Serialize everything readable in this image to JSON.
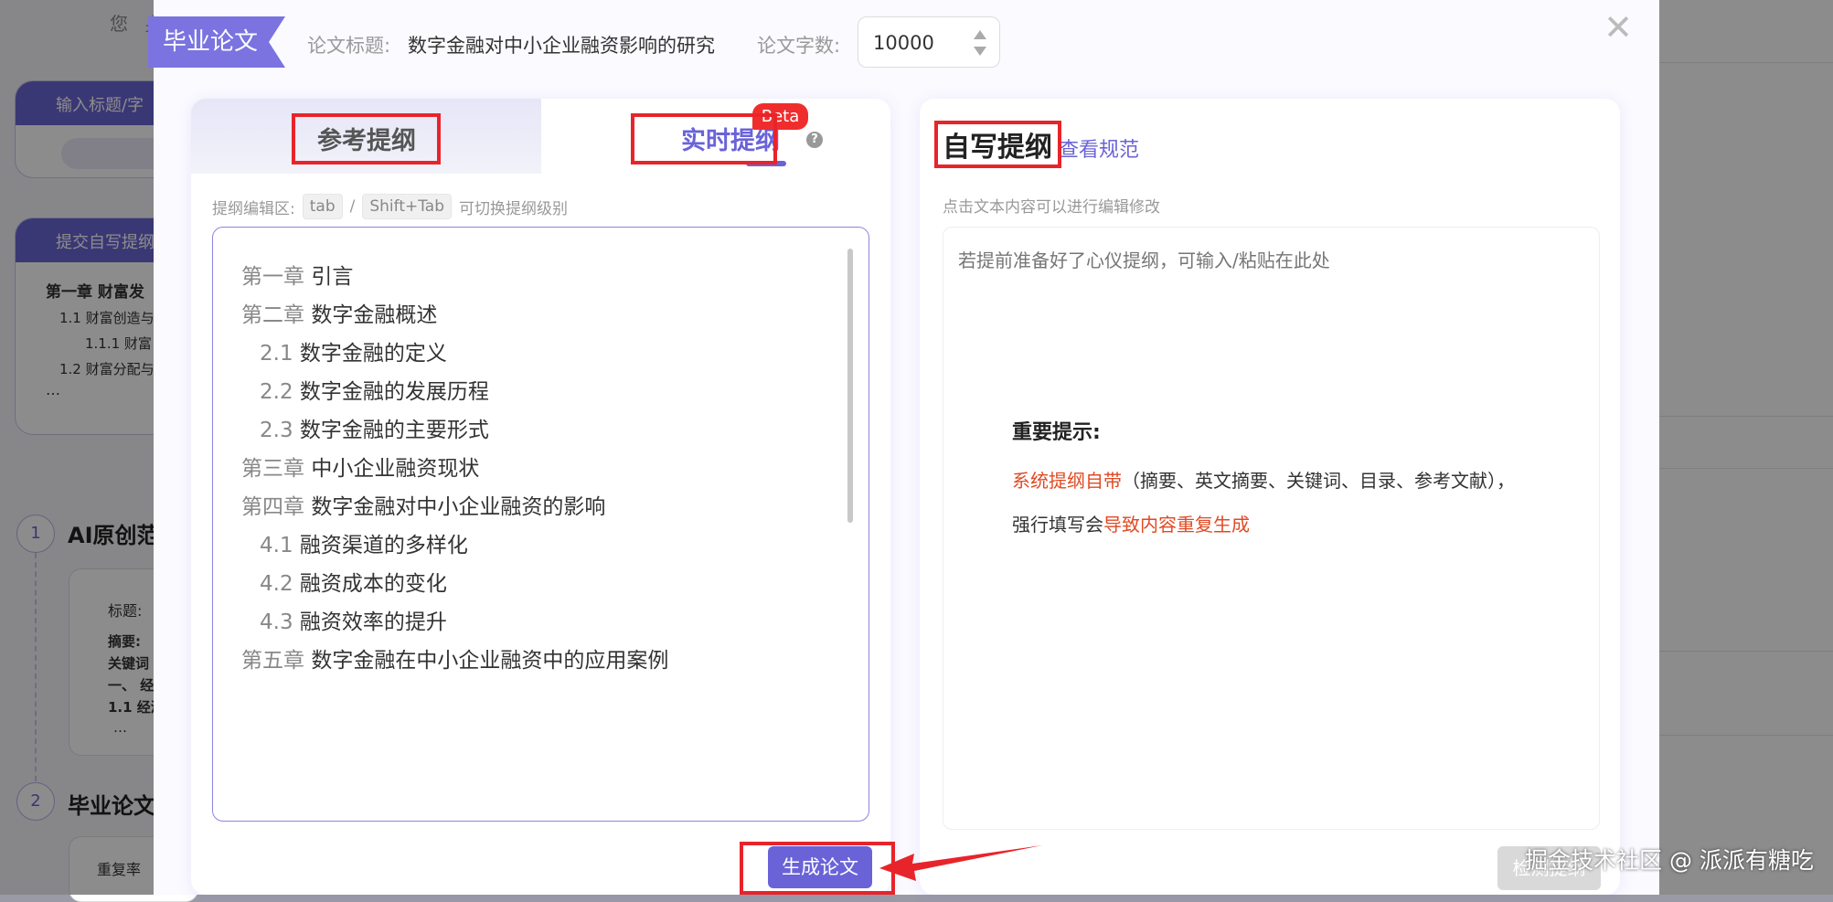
{
  "background": {
    "greeting": "您 身",
    "card1": {
      "header": "输入标题/字"
    },
    "card2": {
      "header": "提交自写提纲",
      "lines": [
        "第一章 财富发",
        "1.1 财富创造与",
        "1.1.1 财富",
        "1.2 财富分配与",
        "…"
      ]
    },
    "steps": [
      {
        "num": "1",
        "title": "AI原创范"
      },
      {
        "num": "2",
        "title": "毕业论文"
      }
    ],
    "sub_card": {
      "lines": [
        "标题:",
        "摘要:",
        "关键词",
        "一、 经",
        "1.1 经济",
        "…"
      ]
    },
    "sub_card2": {
      "text": "重复率"
    }
  },
  "modal": {
    "title_tag": "毕业论文",
    "paper_title_label": "论文标题:",
    "paper_title_value": "数字金融对中小企业融资影响的研究",
    "word_count_label": "论文字数:",
    "word_count_value": "10000",
    "close_icon": "close-icon"
  },
  "left_panel": {
    "tab_reference": "参考提纲",
    "tab_realtime": "实时提纲",
    "beta_badge": "Beta",
    "help_icon": "?",
    "hint_prefix": "提纲编辑区:",
    "hint_key1": "tab",
    "hint_sep": "/",
    "hint_key2": "Shift+Tab",
    "hint_suffix": "可切换提纲级别",
    "outline": [
      {
        "num": "第一章",
        "text": "引言",
        "level": 1
      },
      {
        "num": "第二章",
        "text": "数字金融概述",
        "level": 1
      },
      {
        "num": "2.1",
        "text": "数字金融的定义",
        "level": 2
      },
      {
        "num": "2.2",
        "text": "数字金融的发展历程",
        "level": 2
      },
      {
        "num": "2.3",
        "text": "数字金融的主要形式",
        "level": 2
      },
      {
        "num": "第三章",
        "text": "中小企业融资现状",
        "level": 1
      },
      {
        "num": "第四章",
        "text": "数字金融对中小企业融资的影响",
        "level": 1
      },
      {
        "num": "4.1",
        "text": "融资渠道的多样化",
        "level": 2
      },
      {
        "num": "4.2",
        "text": "融资成本的变化",
        "level": 2
      },
      {
        "num": "4.3",
        "text": "融资效率的提升",
        "level": 2
      },
      {
        "num": "第五章",
        "text": "数字金融在中小企业融资中的应用案例",
        "level": 1
      }
    ],
    "generate_button": "生成论文"
  },
  "right_panel": {
    "title": "自写提纲",
    "view_spec_link": "查看规范",
    "edit_tip": "点击文本内容可以进行编辑修改",
    "placeholder": "若提前准备好了心仪提纲，可输入/粘贴在此处",
    "notice_title": "重要提示:",
    "notice_line1_red": "系统提纲自带",
    "notice_line1_rest": "（摘要、英文摘要、关键词、目录、参考文献），",
    "notice_line2_prefix": "强行填写会",
    "notice_line2_red": "导致内容重复生成"
  },
  "watermark": {
    "button": "检测提纲",
    "text": "掘金技术社区 @ 派派有糖吃"
  },
  "colors": {
    "accent": "#6a63d8",
    "annotation_red": "#e8242b",
    "warning_red": "#e04a24"
  }
}
